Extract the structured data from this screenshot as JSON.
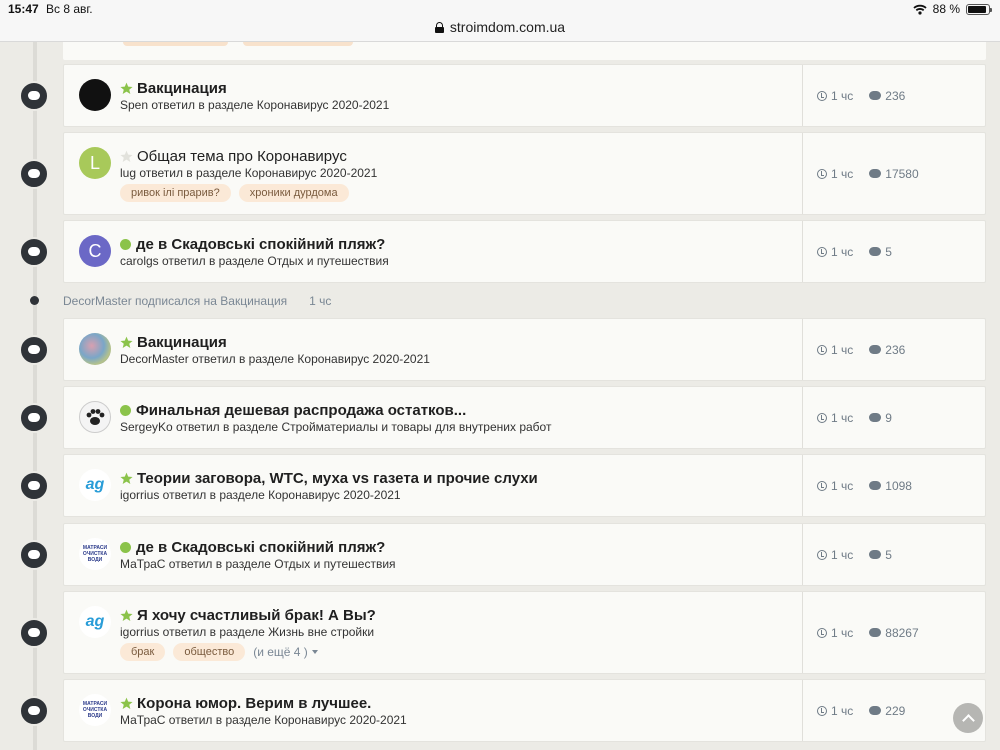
{
  "status_bar": {
    "time": "15:47",
    "date": "Вс 8 авг.",
    "url": "stroimdom.com.ua",
    "battery": "88 %",
    "battery_level": 0.88
  },
  "activity": {
    "text": "DecorMaster подписался на Вакцинация",
    "time": "1 чс"
  },
  "topics": [
    {
      "title": "Вакцинация",
      "marker": "star",
      "avatar": "black",
      "avatar_letter": "",
      "subtitle": "Spen ответил в разделе Коронавирус 2020-2021",
      "time": "1 чс",
      "replies": "236",
      "tags": [],
      "more": ""
    },
    {
      "title": "Общая тема про Коронавирус",
      "marker": "star-empty",
      "avatar": "green",
      "avatar_letter": "L",
      "subtitle": "lug ответил в разделе Коронавирус 2020-2021",
      "time": "1 чс",
      "replies": "17580",
      "tags": [
        "ривок ілі прарив?",
        "хроники дурдома"
      ],
      "more": ""
    },
    {
      "title": "де в Скадовські спокійний пляж?",
      "marker": "dot",
      "avatar": "purple",
      "avatar_letter": "C",
      "subtitle": "carolgs ответил в разделе Отдых и путешествия",
      "time": "1 чс",
      "replies": "5",
      "tags": [],
      "more": ""
    },
    {
      "title": "Вакцинация",
      "marker": "star",
      "avatar": "photo",
      "avatar_letter": "",
      "subtitle": "DecorMaster ответил в разделе Коронавирус 2020-2021",
      "time": "1 чс",
      "replies": "236",
      "tags": [],
      "more": ""
    },
    {
      "title": "Финальная дешевая распродажа остатков...",
      "marker": "dot",
      "avatar": "paw",
      "avatar_letter": "",
      "subtitle": "SergeyKo ответил в разделе Стройматериалы и товары для внутрених работ",
      "time": "1 чс",
      "replies": "9",
      "tags": [],
      "more": ""
    },
    {
      "title": "Теории заговора, WTC, муха vs газета и прочие слухи",
      "marker": "star",
      "avatar": "ag",
      "avatar_letter": "ag",
      "subtitle": "igorrius ответил в разделе Коронавирус 2020-2021",
      "time": "1 чс",
      "replies": "1098",
      "tags": [],
      "more": ""
    },
    {
      "title": "де в Скадовські спокійний пляж?",
      "marker": "dot",
      "avatar": "logo",
      "avatar_letter": "МАТРАСИ ОЧИСТКА ВОДИ",
      "subtitle": "МаТраС ответил в разделе Отдых и путешествия",
      "time": "1 чс",
      "replies": "5",
      "tags": [],
      "more": ""
    },
    {
      "title": "Я хочу счастливый брак! А Вы?",
      "marker": "star",
      "avatar": "ag",
      "avatar_letter": "ag",
      "subtitle": "igorrius ответил в разделе Жизнь вне стройки",
      "time": "1 чс",
      "replies": "88267",
      "tags": [
        "брак",
        "общество"
      ],
      "more": "(и ещё 4 )"
    },
    {
      "title": "Корона юмор. Верим в лучшее.",
      "marker": "star",
      "avatar": "logo",
      "avatar_letter": "МАТРАСИ ОЧИСТКА ВОДИ",
      "subtitle": "МаТраС ответил в разделе Коронавирус 2020-2021",
      "time": "1 чс",
      "replies": "229",
      "tags": [],
      "more": ""
    }
  ],
  "colors": {
    "accent_green": "#8bc34a",
    "timeline_dot": "#2f3338",
    "tag_bg": "#fbe9d7",
    "meta_text": "#6f7b86"
  }
}
